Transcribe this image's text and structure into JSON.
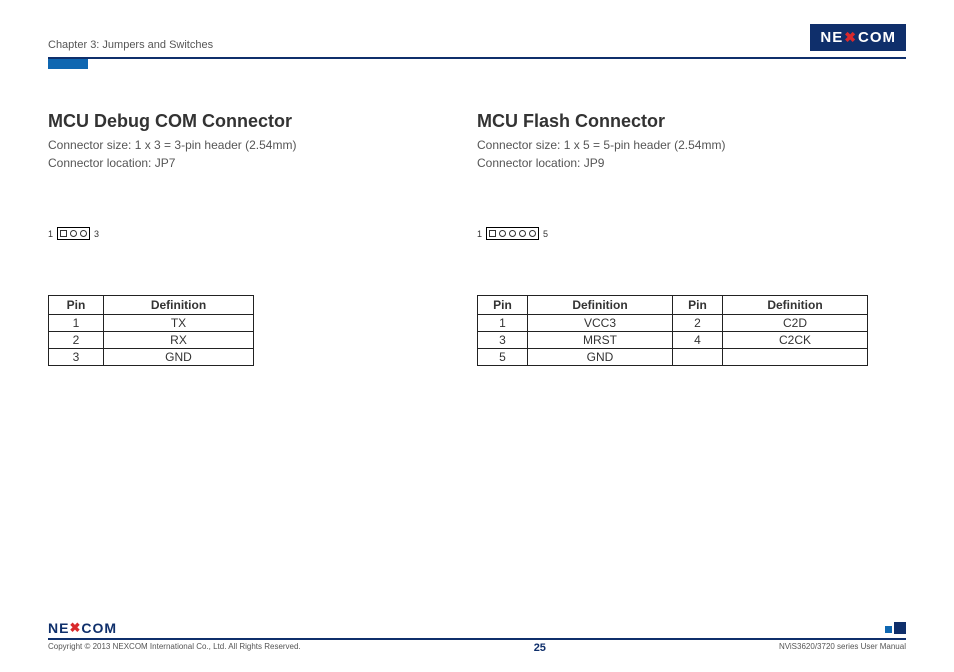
{
  "header": {
    "chapter": "Chapter 3: Jumpers and Switches",
    "brand_prefix": "NE",
    "brand_x": "X",
    "brand_suffix": "COM"
  },
  "left": {
    "title": "MCU Debug COM Connector",
    "size_line": "Connector size: 1 x 3 = 3-pin header (2.54mm)",
    "loc_line": "Connector location: JP7",
    "conn_start": "1",
    "conn_end": "3",
    "table": {
      "headers": [
        "Pin",
        "Definition"
      ],
      "rows": [
        [
          "1",
          "TX"
        ],
        [
          "2",
          "RX"
        ],
        [
          "3",
          "GND"
        ]
      ]
    }
  },
  "right": {
    "title": "MCU Flash Connector",
    "size_line": "Connector size: 1 x 5 = 5-pin header (2.54mm)",
    "loc_line": "Connector location: JP9",
    "conn_start": "1",
    "conn_end": "5",
    "table": {
      "headers": [
        "Pin",
        "Definition",
        "Pin",
        "Definition"
      ],
      "rows": [
        [
          "1",
          "VCC3",
          "2",
          "C2D"
        ],
        [
          "3",
          "MRST",
          "4",
          "C2CK"
        ],
        [
          "5",
          "GND",
          "",
          ""
        ]
      ]
    }
  },
  "footer": {
    "copyright": "Copyright © 2013 NEXCOM International Co., Ltd. All Rights Reserved.",
    "page": "25",
    "doc": "NViS3620/3720 series User Manual"
  }
}
